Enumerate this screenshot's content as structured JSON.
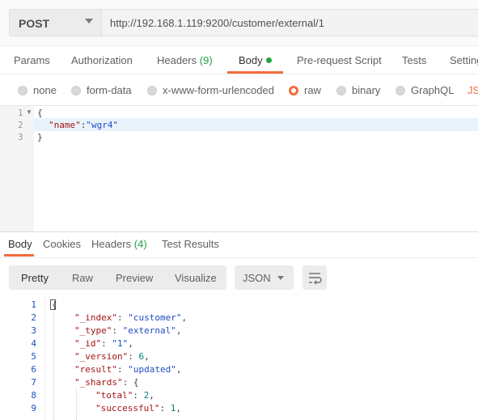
{
  "request": {
    "method": "POST",
    "url": "http://192.168.1.119:9200/customer/external/1"
  },
  "request_tabs": {
    "params": "Params",
    "authorization": "Authorization",
    "headers": "Headers",
    "headers_count": "(9)",
    "body": "Body",
    "pre_request_script": "Pre-request Script",
    "tests": "Tests",
    "settings": "Setting"
  },
  "body_types": {
    "none": "none",
    "form_data": "form-data",
    "urlencoded": "x-www-form-urlencoded",
    "raw": "raw",
    "binary": "binary",
    "graphql": "GraphQL",
    "selected": "raw",
    "json_label": "JS("
  },
  "request_editor": {
    "line_numbers": [
      "1",
      "2",
      "3"
    ],
    "line1": "{",
    "line2_key": "\"name\"",
    "line2_colon": ":",
    "line2_value": "\"wgr4\"",
    "line3": "}"
  },
  "response_tabs": {
    "body": "Body",
    "cookies": "Cookies",
    "headers": "Headers",
    "headers_count": "(4)",
    "test_results": "Test Results"
  },
  "response_toolbar": {
    "pretty": "Pretty",
    "raw": "Raw",
    "preview": "Preview",
    "visualize": "Visualize",
    "format": "JSON",
    "wrap_icon": "wrap-lines-icon"
  },
  "response_editor": {
    "line_numbers": [
      "1",
      "2",
      "3",
      "4",
      "5",
      "6",
      "7",
      "8",
      "9"
    ],
    "l1": "{",
    "l2_key": "\"_index\"",
    "l2_val": "\"customer\"",
    "l3_key": "\"_type\"",
    "l3_val": "\"external\"",
    "l4_key": "\"_id\"",
    "l4_val": "\"1\"",
    "l5_key": "\"_version\"",
    "l5_val": "6",
    "l6_key": "\"result\"",
    "l6_val": "\"updated\"",
    "l7_key": "\"_shards\"",
    "l7_val": "{",
    "l8_key": "\"total\"",
    "l8_val": "2",
    "l9_key": "\"successful\"",
    "l9_val": "1"
  },
  "colors": {
    "accent": "#f26b3a",
    "success": "#22a142",
    "json_key": "#a31515",
    "json_string": "#1f4fbf",
    "json_number": "#008080"
  }
}
